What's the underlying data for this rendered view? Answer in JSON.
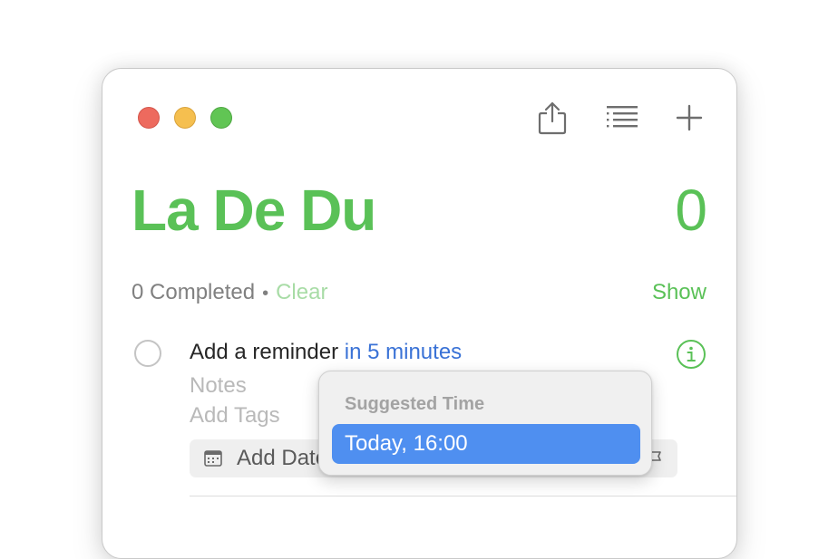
{
  "window": {
    "traffic_lights": [
      "close",
      "minimize",
      "zoom"
    ],
    "toolbar": {
      "share_icon": "share-icon",
      "list_icon": "list-format-icon",
      "add_icon": "plus-icon"
    }
  },
  "list": {
    "title": "La De Du",
    "count": "0",
    "accent_color": "#5ac157"
  },
  "completed": {
    "text": "0 Completed",
    "separator": "•",
    "clear_label": "Clear",
    "show_label": "Show"
  },
  "reminder": {
    "text": "Add a reminder",
    "time_token": "in 5 minutes",
    "notes_placeholder": "Notes",
    "tags_placeholder": "Add Tags",
    "add_date_label": "Add Date",
    "info_icon": "info-icon",
    "calendar_icon": "calendar-icon",
    "flag_icon": "flag-icon"
  },
  "suggestion_popup": {
    "heading": "Suggested Time",
    "options": [
      "Today, 16:00"
    ],
    "selected_color": "#4f8ff0"
  }
}
